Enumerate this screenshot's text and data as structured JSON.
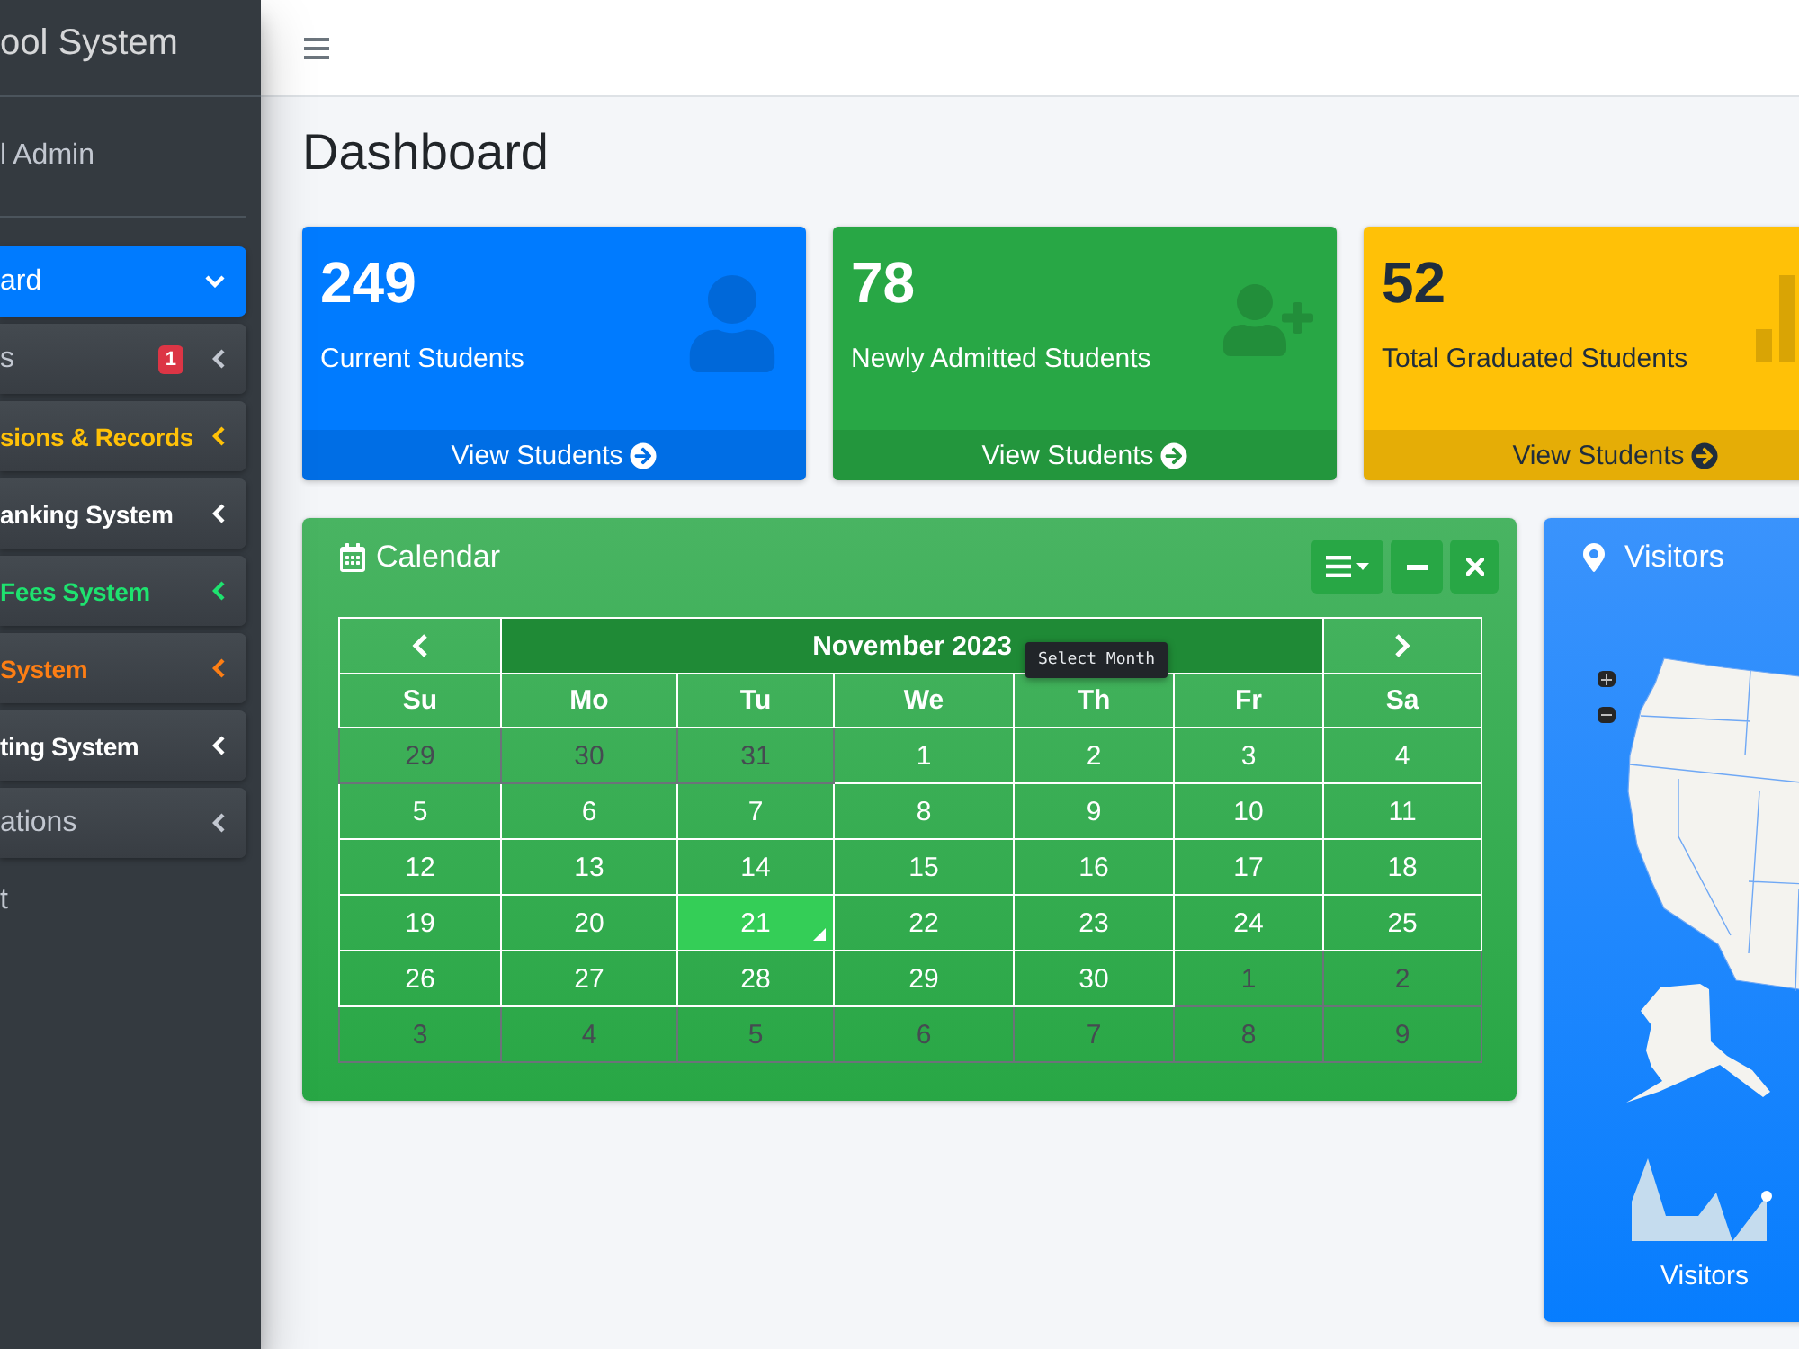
{
  "sidebar": {
    "brand": "ool System",
    "user": "l Admin",
    "items": [
      {
        "label": "ard",
        "kind": "menu",
        "selected": true,
        "expanded": true
      },
      {
        "label": "s",
        "kind": "menu",
        "selected": false,
        "expanded": false,
        "color": "#c2c7d0",
        "badge": "1"
      },
      {
        "label": "sions & Records",
        "kind": "module",
        "selected": false,
        "expanded": false,
        "color": "#ffc107"
      },
      {
        "label": "anking System",
        "kind": "module",
        "selected": false,
        "expanded": false,
        "color": "#ffffff"
      },
      {
        "label": "Fees System",
        "kind": "module",
        "selected": false,
        "expanded": false,
        "color": "#1ee36f"
      },
      {
        "label": "System",
        "kind": "module",
        "selected": false,
        "expanded": false,
        "color": "#fd7e14"
      },
      {
        "label": "ting System",
        "kind": "module",
        "selected": false,
        "expanded": false,
        "color": "#ffffff"
      },
      {
        "label": "ations",
        "kind": "menu",
        "selected": false,
        "expanded": false,
        "color": "#c2c7d0"
      },
      {
        "label": "t",
        "kind": "link",
        "selected": false,
        "color": "#c2c7d0"
      }
    ]
  },
  "page_title": "Dashboard",
  "stat_boxes": [
    {
      "value": "249",
      "label": "Current Students",
      "link": "View Students",
      "kind": "user",
      "color": "#007bff"
    },
    {
      "value": "78",
      "label": "Newly Admitted Students",
      "link": "View Students",
      "kind": "user-plus",
      "color": "#28a745"
    },
    {
      "value": "52",
      "label": "Total Graduated Students",
      "link": "View Students",
      "kind": "bar-chart",
      "color": "#ffc107"
    }
  ],
  "calendar_card": {
    "title": "Calendar",
    "month": "November 2023",
    "tooltip": "Select Month",
    "weekdays": [
      "Su",
      "Mo",
      "Tu",
      "We",
      "Th",
      "Fr",
      "Sa"
    ],
    "weeks": [
      [
        {
          "day": "29",
          "muted": true,
          "selected": false
        },
        {
          "day": "30",
          "muted": true,
          "selected": false
        },
        {
          "day": "31",
          "muted": true,
          "selected": false
        },
        {
          "day": "1",
          "muted": false,
          "selected": false
        },
        {
          "day": "2",
          "muted": false,
          "selected": false
        },
        {
          "day": "3",
          "muted": false,
          "selected": false
        },
        {
          "day": "4",
          "muted": false,
          "selected": false
        }
      ],
      [
        {
          "day": "5",
          "muted": false,
          "selected": false
        },
        {
          "day": "6",
          "muted": false,
          "selected": false
        },
        {
          "day": "7",
          "muted": false,
          "selected": false
        },
        {
          "day": "8",
          "muted": false,
          "selected": false
        },
        {
          "day": "9",
          "muted": false,
          "selected": false
        },
        {
          "day": "10",
          "muted": false,
          "selected": false
        },
        {
          "day": "11",
          "muted": false,
          "selected": false
        }
      ],
      [
        {
          "day": "12",
          "muted": false,
          "selected": false
        },
        {
          "day": "13",
          "muted": false,
          "selected": false
        },
        {
          "day": "14",
          "muted": false,
          "selected": false
        },
        {
          "day": "15",
          "muted": false,
          "selected": false
        },
        {
          "day": "16",
          "muted": false,
          "selected": false
        },
        {
          "day": "17",
          "muted": false,
          "selected": false
        },
        {
          "day": "18",
          "muted": false,
          "selected": false
        }
      ],
      [
        {
          "day": "19",
          "muted": false,
          "selected": false
        },
        {
          "day": "20",
          "muted": false,
          "selected": false
        },
        {
          "day": "21",
          "muted": false,
          "selected": true
        },
        {
          "day": "22",
          "muted": false,
          "selected": false
        },
        {
          "day": "23",
          "muted": false,
          "selected": false
        },
        {
          "day": "24",
          "muted": false,
          "selected": false
        },
        {
          "day": "25",
          "muted": false,
          "selected": false
        }
      ],
      [
        {
          "day": "26",
          "muted": false,
          "selected": false
        },
        {
          "day": "27",
          "muted": false,
          "selected": false
        },
        {
          "day": "28",
          "muted": false,
          "selected": false
        },
        {
          "day": "29",
          "muted": false,
          "selected": false
        },
        {
          "day": "30",
          "muted": false,
          "selected": false
        },
        {
          "day": "1",
          "muted": true,
          "selected": false
        },
        {
          "day": "2",
          "muted": true,
          "selected": false
        }
      ],
      [
        {
          "day": "3",
          "muted": true,
          "selected": false
        },
        {
          "day": "4",
          "muted": true,
          "selected": false
        },
        {
          "day": "5",
          "muted": true,
          "selected": false
        },
        {
          "day": "6",
          "muted": true,
          "selected": false
        },
        {
          "day": "7",
          "muted": true,
          "selected": false
        },
        {
          "day": "8",
          "muted": true,
          "selected": false
        },
        {
          "day": "9",
          "muted": true,
          "selected": false
        }
      ]
    ]
  },
  "visitors_card": {
    "title": "Visitors",
    "sparkline_label": "Visitors"
  }
}
